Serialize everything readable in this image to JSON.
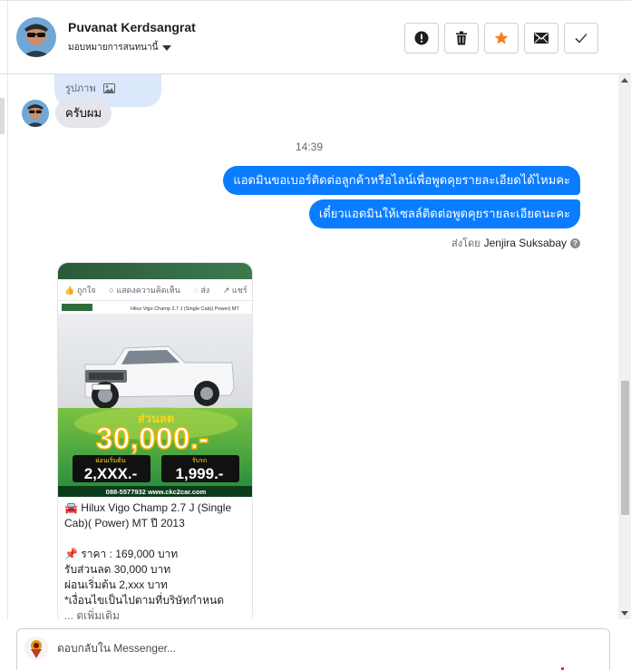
{
  "header": {
    "contact_name": "Puvanat Kerdsangrat",
    "assign_label": "มอบหมายการสนทนานี้",
    "actions": [
      {
        "name": "mark-spam-button",
        "icon": "alert-icon"
      },
      {
        "name": "delete-button",
        "icon": "trash-icon"
      },
      {
        "name": "star-button",
        "icon": "star-icon"
      },
      {
        "name": "mark-unread-button",
        "icon": "envelope-icon"
      },
      {
        "name": "mark-done-button",
        "icon": "check-icon"
      }
    ]
  },
  "messages": {
    "photo_label": "รูปภาพ",
    "incoming_text": "ครับผม",
    "timestamp": "14:39",
    "outgoing": [
      "แอดมินขอเบอร์ติดต่อลูกค้าหรือไลน์เพื่อพูดคุยรายละเอียดได้ไหมคะ",
      "เดี๋ยวแอดมินให้เซลล์ติดต่อพูดคุยรายละเอียดนะคะ"
    ],
    "sent_by_prefix": "ส่งโดย",
    "sent_by_agent": "Jenjira Suksabay"
  },
  "shared_post": {
    "actions": [
      "ถูกใจ",
      "แสดงความคิดเห็น",
      "ส่ง",
      "แชร์"
    ],
    "image": {
      "header_text": "Hilux Vigo Champ 2.7 J (Single Cab)( Power) MT",
      "discount_title": "ส่วนลด",
      "discount_value": "30,000.-",
      "installment_label": "ผ่อนเริ่มต้น",
      "installment_value": "2,XXX.-",
      "downpay_label": "รับรถ",
      "downpay_value": "1,999.-",
      "contact": "088-5577932 www.ckc2car.com"
    },
    "title_line1": "🚘 Hilux Vigo Champ 2.7 J (Single",
    "title_line2": "Cab)( Power) MT ปี 2013",
    "price": "📌 ราคา : 169,000 บาท",
    "discount": "รับส่วนลด 30,000 บาท",
    "installment": "ผ่อนเริ่มต้น 2,xxx บาท",
    "conditions": "*เงื่อนไขเป็นไปตามที่บริษัทกำหนด",
    "see_more": "... ดูเพิ่มเติม"
  },
  "composer": {
    "placeholder": "ตอบกลับใน Messenger..."
  },
  "colors": {
    "outgoing_bubble": "#0a7cff",
    "incoming_bubble": "#e4e6eb",
    "star": "#f57c24",
    "banner_green": "#2e9a3c",
    "banner_yellow": "#f9d71c"
  }
}
